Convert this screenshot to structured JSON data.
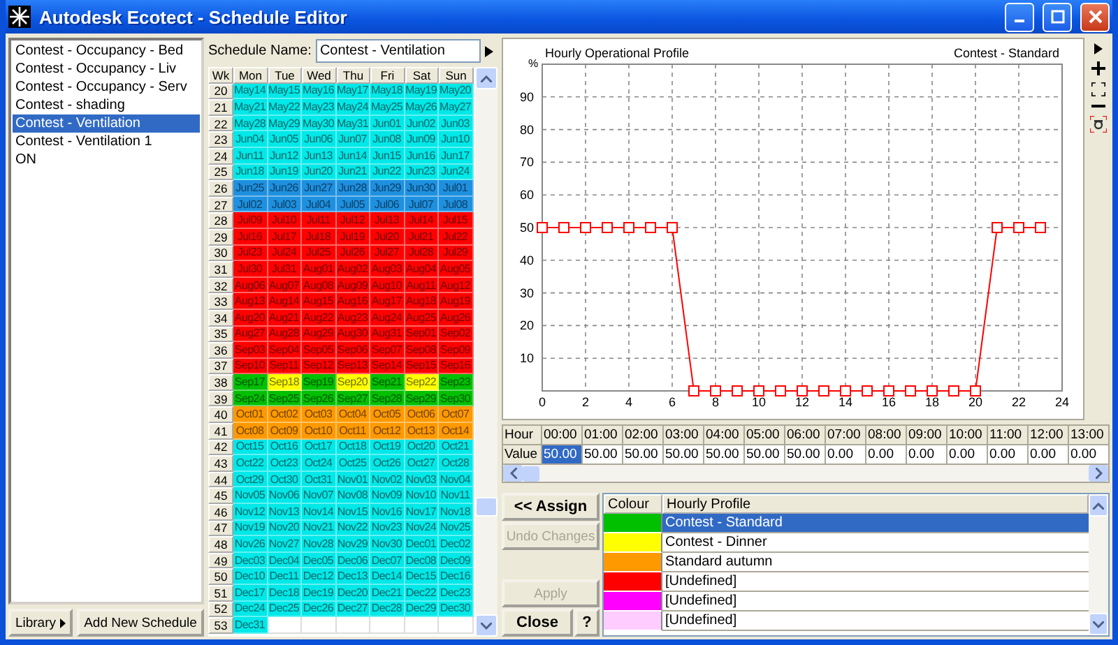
{
  "window": {
    "title": "Autodesk Ecotect - Schedule Editor"
  },
  "schedules": [
    {
      "label": "Contest - Occupancy - Bed",
      "selected": false
    },
    {
      "label": "Contest - Occupancy - Liv",
      "selected": false
    },
    {
      "label": "Contest - Occupancy - Serv",
      "selected": false
    },
    {
      "label": "Contest - shading",
      "selected": false
    },
    {
      "label": "Contest - Ventilation",
      "selected": true
    },
    {
      "label": "Contest - Ventilation 1",
      "selected": false
    },
    {
      "label": "ON",
      "selected": false
    }
  ],
  "library_button": "Library",
  "add_button": "Add New Schedule",
  "schedule_name": {
    "label": "Schedule Name:",
    "value": "Contest - Ventilation"
  },
  "calendar": {
    "columns": [
      "Wk",
      "Mon",
      "Tue",
      "Wed",
      "Thu",
      "Fri",
      "Sat",
      "Sun"
    ],
    "weeks": [
      {
        "wk": "20",
        "days": [
          {
            "text": "May14",
            "color": "#00e8e8"
          },
          {
            "text": "May15",
            "color": "#00e8e8"
          },
          {
            "text": "May16",
            "color": "#00e8e8"
          },
          {
            "text": "May17",
            "color": "#00e8e8"
          },
          {
            "text": "May18",
            "color": "#00e8e8"
          },
          {
            "text": "May19",
            "color": "#00e8e8"
          },
          {
            "text": "May20",
            "color": "#00e8e8"
          }
        ]
      },
      {
        "wk": "21",
        "days": [
          {
            "text": "May21",
            "color": "#00e8e8"
          },
          {
            "text": "May22",
            "color": "#00e8e8"
          },
          {
            "text": "May23",
            "color": "#00e8e8"
          },
          {
            "text": "May24",
            "color": "#00e8e8"
          },
          {
            "text": "May25",
            "color": "#00e8e8"
          },
          {
            "text": "May26",
            "color": "#00e8e8"
          },
          {
            "text": "May27",
            "color": "#00e8e8"
          }
        ]
      },
      {
        "wk": "22",
        "days": [
          {
            "text": "May28",
            "color": "#00e8e8"
          },
          {
            "text": "May29",
            "color": "#00e8e8"
          },
          {
            "text": "May30",
            "color": "#00e8e8"
          },
          {
            "text": "May31",
            "color": "#00e8e8"
          },
          {
            "text": "Jun01",
            "color": "#00e8e8"
          },
          {
            "text": "Jun02",
            "color": "#00e8e8"
          },
          {
            "text": "Jun03",
            "color": "#00e8e8"
          }
        ]
      },
      {
        "wk": "23",
        "days": [
          {
            "text": "Jun04",
            "color": "#00e8e8"
          },
          {
            "text": "Jun05",
            "color": "#00e8e8"
          },
          {
            "text": "Jun06",
            "color": "#00e8e8"
          },
          {
            "text": "Jun07",
            "color": "#00e8e8"
          },
          {
            "text": "Jun08",
            "color": "#00e8e8"
          },
          {
            "text": "Jun09",
            "color": "#00e8e8"
          },
          {
            "text": "Jun10",
            "color": "#00e8e8"
          }
        ]
      },
      {
        "wk": "24",
        "days": [
          {
            "text": "Jun11",
            "color": "#00e8e8"
          },
          {
            "text": "Jun12",
            "color": "#00e8e8"
          },
          {
            "text": "Jun13",
            "color": "#00e8e8"
          },
          {
            "text": "Jun14",
            "color": "#00e8e8"
          },
          {
            "text": "Jun15",
            "color": "#00e8e8"
          },
          {
            "text": "Jun16",
            "color": "#00e8e8"
          },
          {
            "text": "Jun17",
            "color": "#00e8e8"
          }
        ]
      },
      {
        "wk": "25",
        "days": [
          {
            "text": "Jun18",
            "color": "#00e8e8"
          },
          {
            "text": "Jun19",
            "color": "#00e8e8"
          },
          {
            "text": "Jun20",
            "color": "#00e8e8"
          },
          {
            "text": "Jun21",
            "color": "#00e8e8"
          },
          {
            "text": "Jun22",
            "color": "#00e8e8"
          },
          {
            "text": "Jun23",
            "color": "#00e8e8"
          },
          {
            "text": "Jun24",
            "color": "#00e8e8"
          }
        ]
      },
      {
        "wk": "26",
        "days": [
          {
            "text": "Jun25",
            "color": "#1e90e0"
          },
          {
            "text": "Jun26",
            "color": "#1e90e0"
          },
          {
            "text": "Jun27",
            "color": "#1e90e0"
          },
          {
            "text": "Jun28",
            "color": "#1e90e0"
          },
          {
            "text": "Jun29",
            "color": "#1e90e0"
          },
          {
            "text": "Jun30",
            "color": "#1e90e0"
          },
          {
            "text": "Jul01",
            "color": "#1e90e0"
          }
        ]
      },
      {
        "wk": "27",
        "days": [
          {
            "text": "Jul02",
            "color": "#1e90e0"
          },
          {
            "text": "Jul03",
            "color": "#1e90e0"
          },
          {
            "text": "Jul04",
            "color": "#1e90e0"
          },
          {
            "text": "Jul05",
            "color": "#1e90e0"
          },
          {
            "text": "Jul06",
            "color": "#1e90e0"
          },
          {
            "text": "Jul07",
            "color": "#1e90e0"
          },
          {
            "text": "Jul08",
            "color": "#1e90e0"
          }
        ]
      },
      {
        "wk": "28",
        "days": [
          {
            "text": "Jul09",
            "color": "#ff0000"
          },
          {
            "text": "Jul10",
            "color": "#ff0000"
          },
          {
            "text": "Jul11",
            "color": "#ff0000"
          },
          {
            "text": "Jul12",
            "color": "#ff0000"
          },
          {
            "text": "Jul13",
            "color": "#ff0000"
          },
          {
            "text": "Jul14",
            "color": "#ff0000"
          },
          {
            "text": "Jul15",
            "color": "#ff0000"
          }
        ]
      },
      {
        "wk": "29",
        "days": [
          {
            "text": "Jul16",
            "color": "#ff0000"
          },
          {
            "text": "Jul17",
            "color": "#ff0000"
          },
          {
            "text": "Jul18",
            "color": "#ff0000"
          },
          {
            "text": "Jul19",
            "color": "#ff0000"
          },
          {
            "text": "Jul20",
            "color": "#ff0000"
          },
          {
            "text": "Jul21",
            "color": "#ff0000"
          },
          {
            "text": "Jul22",
            "color": "#ff0000"
          }
        ]
      },
      {
        "wk": "30",
        "days": [
          {
            "text": "Jul23",
            "color": "#ff0000"
          },
          {
            "text": "Jul24",
            "color": "#ff0000"
          },
          {
            "text": "Jul25",
            "color": "#ff0000"
          },
          {
            "text": "Jul26",
            "color": "#ff0000"
          },
          {
            "text": "Jul27",
            "color": "#ff0000"
          },
          {
            "text": "Jul28",
            "color": "#ff0000"
          },
          {
            "text": "Jul29",
            "color": "#ff0000"
          }
        ]
      },
      {
        "wk": "31",
        "days": [
          {
            "text": "Jul30",
            "color": "#ff0000"
          },
          {
            "text": "Jul31",
            "color": "#ff0000"
          },
          {
            "text": "Aug01",
            "color": "#ff0000"
          },
          {
            "text": "Aug02",
            "color": "#ff0000"
          },
          {
            "text": "Aug03",
            "color": "#ff0000"
          },
          {
            "text": "Aug04",
            "color": "#ff0000"
          },
          {
            "text": "Aug05",
            "color": "#ff0000"
          }
        ]
      },
      {
        "wk": "32",
        "days": [
          {
            "text": "Aug06",
            "color": "#ff0000"
          },
          {
            "text": "Aug07",
            "color": "#ff0000"
          },
          {
            "text": "Aug08",
            "color": "#ff0000"
          },
          {
            "text": "Aug09",
            "color": "#ff0000"
          },
          {
            "text": "Aug10",
            "color": "#ff0000"
          },
          {
            "text": "Aug11",
            "color": "#ff0000"
          },
          {
            "text": "Aug12",
            "color": "#ff0000"
          }
        ]
      },
      {
        "wk": "33",
        "days": [
          {
            "text": "Aug13",
            "color": "#ff0000"
          },
          {
            "text": "Aug14",
            "color": "#ff0000"
          },
          {
            "text": "Aug15",
            "color": "#ff0000"
          },
          {
            "text": "Aug16",
            "color": "#ff0000"
          },
          {
            "text": "Aug17",
            "color": "#ff0000"
          },
          {
            "text": "Aug18",
            "color": "#ff0000"
          },
          {
            "text": "Aug19",
            "color": "#ff0000"
          }
        ]
      },
      {
        "wk": "34",
        "days": [
          {
            "text": "Aug20",
            "color": "#ff0000"
          },
          {
            "text": "Aug21",
            "color": "#ff0000"
          },
          {
            "text": "Aug22",
            "color": "#ff0000"
          },
          {
            "text": "Aug23",
            "color": "#ff0000"
          },
          {
            "text": "Aug24",
            "color": "#ff0000"
          },
          {
            "text": "Aug25",
            "color": "#ff0000"
          },
          {
            "text": "Aug26",
            "color": "#ff0000"
          }
        ]
      },
      {
        "wk": "35",
        "days": [
          {
            "text": "Aug27",
            "color": "#ff0000"
          },
          {
            "text": "Aug28",
            "color": "#ff0000"
          },
          {
            "text": "Aug29",
            "color": "#ff0000"
          },
          {
            "text": "Aug30",
            "color": "#ff0000"
          },
          {
            "text": "Aug31",
            "color": "#ff0000"
          },
          {
            "text": "Sep01",
            "color": "#ff0000"
          },
          {
            "text": "Sep02",
            "color": "#ff0000"
          }
        ]
      },
      {
        "wk": "36",
        "days": [
          {
            "text": "Sep03",
            "color": "#ff0000"
          },
          {
            "text": "Sep04",
            "color": "#ff0000"
          },
          {
            "text": "Sep05",
            "color": "#ff0000"
          },
          {
            "text": "Sep06",
            "color": "#ff0000"
          },
          {
            "text": "Sep07",
            "color": "#ff0000"
          },
          {
            "text": "Sep08",
            "color": "#ff0000"
          },
          {
            "text": "Sep09",
            "color": "#ff0000"
          }
        ]
      },
      {
        "wk": "37",
        "days": [
          {
            "text": "Sep10",
            "color": "#ff0000"
          },
          {
            "text": "Sep11",
            "color": "#ff0000"
          },
          {
            "text": "Sep12",
            "color": "#ff0000"
          },
          {
            "text": "Sep13",
            "color": "#ff0000"
          },
          {
            "text": "Sep14",
            "color": "#ff0000"
          },
          {
            "text": "Sep15",
            "color": "#ff0000"
          },
          {
            "text": "Sep16",
            "color": "#ff0000"
          }
        ]
      },
      {
        "wk": "38",
        "days": [
          {
            "text": "Sep17",
            "color": "#00c000"
          },
          {
            "text": "Sep18",
            "color": "#ffff00"
          },
          {
            "text": "Sep19",
            "color": "#00c000"
          },
          {
            "text": "Sep20",
            "color": "#ffff00"
          },
          {
            "text": "Sep21",
            "color": "#00c000"
          },
          {
            "text": "Sep22",
            "color": "#ffff00"
          },
          {
            "text": "Sep23",
            "color": "#00c000"
          }
        ]
      },
      {
        "wk": "39",
        "days": [
          {
            "text": "Sep24",
            "color": "#00c000"
          },
          {
            "text": "Sep25",
            "color": "#00c000"
          },
          {
            "text": "Sep26",
            "color": "#00c000"
          },
          {
            "text": "Sep27",
            "color": "#00c000"
          },
          {
            "text": "Sep28",
            "color": "#00c000"
          },
          {
            "text": "Sep29",
            "color": "#00c000"
          },
          {
            "text": "Sep30",
            "color": "#00c000"
          }
        ]
      },
      {
        "wk": "40",
        "days": [
          {
            "text": "Oct01",
            "color": "#ff9900"
          },
          {
            "text": "Oct02",
            "color": "#ff9900"
          },
          {
            "text": "Oct03",
            "color": "#ff9900"
          },
          {
            "text": "Oct04",
            "color": "#ff9900"
          },
          {
            "text": "Oct05",
            "color": "#ff9900"
          },
          {
            "text": "Oct06",
            "color": "#ff9900"
          },
          {
            "text": "Oct07",
            "color": "#ff9900"
          }
        ]
      },
      {
        "wk": "41",
        "days": [
          {
            "text": "Oct08",
            "color": "#ff9900"
          },
          {
            "text": "Oct09",
            "color": "#ff9900"
          },
          {
            "text": "Oct10",
            "color": "#ff9900"
          },
          {
            "text": "Oct11",
            "color": "#ff9900"
          },
          {
            "text": "Oct12",
            "color": "#ff9900"
          },
          {
            "text": "Oct13",
            "color": "#ff9900"
          },
          {
            "text": "Oct14",
            "color": "#ff9900"
          }
        ]
      },
      {
        "wk": "42",
        "days": [
          {
            "text": "Oct15",
            "color": "#00e8e8"
          },
          {
            "text": "Oct16",
            "color": "#00e8e8"
          },
          {
            "text": "Oct17",
            "color": "#00e8e8"
          },
          {
            "text": "Oct18",
            "color": "#00e8e8"
          },
          {
            "text": "Oct19",
            "color": "#00e8e8"
          },
          {
            "text": "Oct20",
            "color": "#00e8e8"
          },
          {
            "text": "Oct21",
            "color": "#00e8e8"
          }
        ]
      },
      {
        "wk": "43",
        "days": [
          {
            "text": "Oct22",
            "color": "#00e8e8"
          },
          {
            "text": "Oct23",
            "color": "#00e8e8"
          },
          {
            "text": "Oct24",
            "color": "#00e8e8"
          },
          {
            "text": "Oct25",
            "color": "#00e8e8"
          },
          {
            "text": "Oct26",
            "color": "#00e8e8"
          },
          {
            "text": "Oct27",
            "color": "#00e8e8"
          },
          {
            "text": "Oct28",
            "color": "#00e8e8"
          }
        ]
      },
      {
        "wk": "44",
        "days": [
          {
            "text": "Oct29",
            "color": "#00e8e8"
          },
          {
            "text": "Oct30",
            "color": "#00e8e8"
          },
          {
            "text": "Oct31",
            "color": "#00e8e8"
          },
          {
            "text": "Nov01",
            "color": "#00e8e8"
          },
          {
            "text": "Nov02",
            "color": "#00e8e8"
          },
          {
            "text": "Nov03",
            "color": "#00e8e8"
          },
          {
            "text": "Nov04",
            "color": "#00e8e8"
          }
        ]
      },
      {
        "wk": "45",
        "days": [
          {
            "text": "Nov05",
            "color": "#00e8e8"
          },
          {
            "text": "Nov06",
            "color": "#00e8e8"
          },
          {
            "text": "Nov07",
            "color": "#00e8e8"
          },
          {
            "text": "Nov08",
            "color": "#00e8e8"
          },
          {
            "text": "Nov09",
            "color": "#00e8e8"
          },
          {
            "text": "Nov10",
            "color": "#00e8e8"
          },
          {
            "text": "Nov11",
            "color": "#00e8e8"
          }
        ]
      },
      {
        "wk": "46",
        "days": [
          {
            "text": "Nov12",
            "color": "#00e8e8"
          },
          {
            "text": "Nov13",
            "color": "#00e8e8"
          },
          {
            "text": "Nov14",
            "color": "#00e8e8"
          },
          {
            "text": "Nov15",
            "color": "#00e8e8"
          },
          {
            "text": "Nov16",
            "color": "#00e8e8"
          },
          {
            "text": "Nov17",
            "color": "#00e8e8"
          },
          {
            "text": "Nov18",
            "color": "#00e8e8"
          }
        ]
      },
      {
        "wk": "47",
        "days": [
          {
            "text": "Nov19",
            "color": "#00e8e8"
          },
          {
            "text": "Nov20",
            "color": "#00e8e8"
          },
          {
            "text": "Nov21",
            "color": "#00e8e8"
          },
          {
            "text": "Nov22",
            "color": "#00e8e8"
          },
          {
            "text": "Nov23",
            "color": "#00e8e8"
          },
          {
            "text": "Nov24",
            "color": "#00e8e8"
          },
          {
            "text": "Nov25",
            "color": "#00e8e8"
          }
        ]
      },
      {
        "wk": "48",
        "days": [
          {
            "text": "Nov26",
            "color": "#00e8e8"
          },
          {
            "text": "Nov27",
            "color": "#00e8e8"
          },
          {
            "text": "Nov28",
            "color": "#00e8e8"
          },
          {
            "text": "Nov29",
            "color": "#00e8e8"
          },
          {
            "text": "Nov30",
            "color": "#00e8e8"
          },
          {
            "text": "Dec01",
            "color": "#00e8e8"
          },
          {
            "text": "Dec02",
            "color": "#00e8e8"
          }
        ]
      },
      {
        "wk": "49",
        "days": [
          {
            "text": "Dec03",
            "color": "#00e8e8"
          },
          {
            "text": "Dec04",
            "color": "#00e8e8"
          },
          {
            "text": "Dec05",
            "color": "#00e8e8"
          },
          {
            "text": "Dec06",
            "color": "#00e8e8"
          },
          {
            "text": "Dec07",
            "color": "#00e8e8"
          },
          {
            "text": "Dec08",
            "color": "#00e8e8"
          },
          {
            "text": "Dec09",
            "color": "#00e8e8"
          }
        ]
      },
      {
        "wk": "50",
        "days": [
          {
            "text": "Dec10",
            "color": "#00e8e8"
          },
          {
            "text": "Dec11",
            "color": "#00e8e8"
          },
          {
            "text": "Dec12",
            "color": "#00e8e8"
          },
          {
            "text": "Dec13",
            "color": "#00e8e8"
          },
          {
            "text": "Dec14",
            "color": "#00e8e8"
          },
          {
            "text": "Dec15",
            "color": "#00e8e8"
          },
          {
            "text": "Dec16",
            "color": "#00e8e8"
          }
        ]
      },
      {
        "wk": "51",
        "days": [
          {
            "text": "Dec17",
            "color": "#00e8e8"
          },
          {
            "text": "Dec18",
            "color": "#00e8e8"
          },
          {
            "text": "Dec19",
            "color": "#00e8e8"
          },
          {
            "text": "Dec20",
            "color": "#00e8e8"
          },
          {
            "text": "Dec21",
            "color": "#00e8e8"
          },
          {
            "text": "Dec22",
            "color": "#00e8e8"
          },
          {
            "text": "Dec23",
            "color": "#00e8e8"
          }
        ]
      },
      {
        "wk": "52",
        "days": [
          {
            "text": "Dec24",
            "color": "#00e8e8"
          },
          {
            "text": "Dec25",
            "color": "#00e8e8"
          },
          {
            "text": "Dec26",
            "color": "#00e8e8"
          },
          {
            "text": "Dec27",
            "color": "#00e8e8"
          },
          {
            "text": "Dec28",
            "color": "#00e8e8"
          },
          {
            "text": "Dec29",
            "color": "#00e8e8"
          },
          {
            "text": "Dec30",
            "color": "#00e8e8"
          }
        ]
      },
      {
        "wk": "53",
        "days": [
          {
            "text": "Dec31",
            "color": "#00e8e8"
          }
        ]
      }
    ]
  },
  "chart": {
    "chart_data": {
      "type": "line",
      "title": "Hourly Operational Profile",
      "ylabel": "%",
      "x": [
        0,
        1,
        2,
        3,
        4,
        5,
        6,
        7,
        8,
        9,
        10,
        11,
        12,
        13,
        14,
        15,
        16,
        17,
        18,
        19,
        20,
        21,
        22,
        23
      ],
      "grid": true,
      "series": [
        {
          "name": "Contest - Standard",
          "color": "#ff0000",
          "marker": "square",
          "values": [
            50,
            50,
            50,
            50,
            50,
            50,
            50,
            0,
            0,
            0,
            0,
            0,
            0,
            0,
            0,
            0,
            0,
            0,
            0,
            0,
            0,
            50,
            50,
            50
          ]
        }
      ],
      "xlim": [
        0,
        24
      ],
      "ylim": [
        0,
        100
      ],
      "xticks": [
        0,
        2,
        4,
        6,
        8,
        10,
        12,
        14,
        16,
        18,
        20,
        22,
        24
      ],
      "yticks": [
        10,
        20,
        30,
        40,
        50,
        60,
        70,
        80,
        90
      ]
    }
  },
  "hour_table": {
    "row_labels": [
      "Hour",
      "Value"
    ],
    "cells": [
      {
        "hour": "00:00",
        "value": "50.00",
        "selected": true
      },
      {
        "hour": "01:00",
        "value": "50.00",
        "selected": false
      },
      {
        "hour": "02:00",
        "value": "50.00",
        "selected": false
      },
      {
        "hour": "03:00",
        "value": "50.00",
        "selected": false
      },
      {
        "hour": "04:00",
        "value": "50.00",
        "selected": false
      },
      {
        "hour": "05:00",
        "value": "50.00",
        "selected": false
      },
      {
        "hour": "06:00",
        "value": "50.00",
        "selected": false
      },
      {
        "hour": "07:00",
        "value": "0.00",
        "selected": false
      },
      {
        "hour": "08:00",
        "value": "0.00",
        "selected": false
      },
      {
        "hour": "09:00",
        "value": "0.00",
        "selected": false
      },
      {
        "hour": "10:00",
        "value": "0.00",
        "selected": false
      },
      {
        "hour": "11:00",
        "value": "0.00",
        "selected": false
      },
      {
        "hour": "12:00",
        "value": "0.00",
        "selected": false
      },
      {
        "hour": "13:00",
        "value": "0.00",
        "selected": false
      }
    ]
  },
  "actions": [
    {
      "label": "<< Assign",
      "disabled": false
    },
    {
      "label": "Undo Changes",
      "disabled": true
    },
    {
      "label": "Apply",
      "disabled": true
    }
  ],
  "close_button": "Close",
  "help_button": "?",
  "profiles": {
    "columns": [
      "Colour",
      "Hourly Profile"
    ],
    "rows": [
      {
        "name": "Contest - Standard",
        "color": "#00c000",
        "selected": true
      },
      {
        "name": "Contest - Dinner",
        "color": "#ffff00",
        "selected": false
      },
      {
        "name": "Standard autumn",
        "color": "#ff9900",
        "selected": false
      },
      {
        "name": "[Undefined]",
        "color": "#ff0000",
        "selected": false
      },
      {
        "name": "[Undefined]",
        "color": "#ff00ff",
        "selected": false
      },
      {
        "name": "[Undefined]",
        "color": "#ffccff",
        "selected": false
      }
    ]
  }
}
